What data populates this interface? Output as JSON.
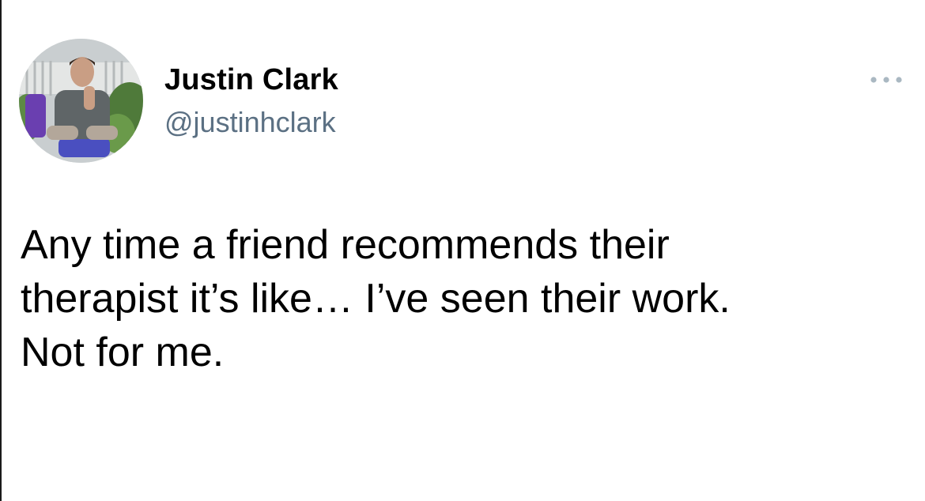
{
  "tweet": {
    "author": {
      "display_name": "Justin Clark",
      "handle": "@justinhclark",
      "avatar_icon": "profile-photo"
    },
    "more_icon": "more-options-icon",
    "text_lines": [
      "Any time a friend recommends their",
      "therapist it’s like… I’ve seen their work.",
      "Not for me."
    ]
  },
  "colors": {
    "background": "#ffffff",
    "text": "#000000",
    "handle": "#5b7083",
    "more_dots": "#aab8c2"
  }
}
